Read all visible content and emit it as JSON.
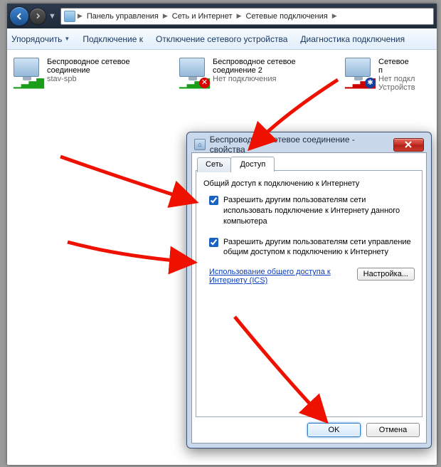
{
  "breadcrumb": {
    "seg1": "Панель управления",
    "seg2": "Сеть и Интернет",
    "seg3": "Сетевые подключения"
  },
  "toolbar": {
    "organize": "Упорядочить",
    "connect": "Подключение к",
    "disable": "Отключение сетевого устройства",
    "diagnose": "Диагностика подключения"
  },
  "connections": [
    {
      "title": "Беспроводное сетевое соединение",
      "sub": "stav-spb",
      "status": "ok"
    },
    {
      "title": "Беспроводное сетевое соединение 2",
      "sub": "Нет подключения",
      "status": "err"
    },
    {
      "title": "Сетевое п",
      "sub": "Нет подкл",
      "sub2": "Устройств",
      "status": "bt"
    }
  ],
  "dialog": {
    "title": "Беспроводное сетевое соединение - свойства",
    "tabs": {
      "net": "Сеть",
      "share": "Доступ"
    },
    "group": "Общий доступ к подключению к Интернету",
    "check1": "Разрешить другим пользователям сети использовать подключение к Интернету данного компьютера",
    "check2": "Разрешить другим пользователям сети управление общим доступом к подключению к Интернету",
    "link": "Использование общего доступа к Интернету (ICS)",
    "settings": "Настройка...",
    "ok": "OK",
    "cancel": "Отмена"
  }
}
